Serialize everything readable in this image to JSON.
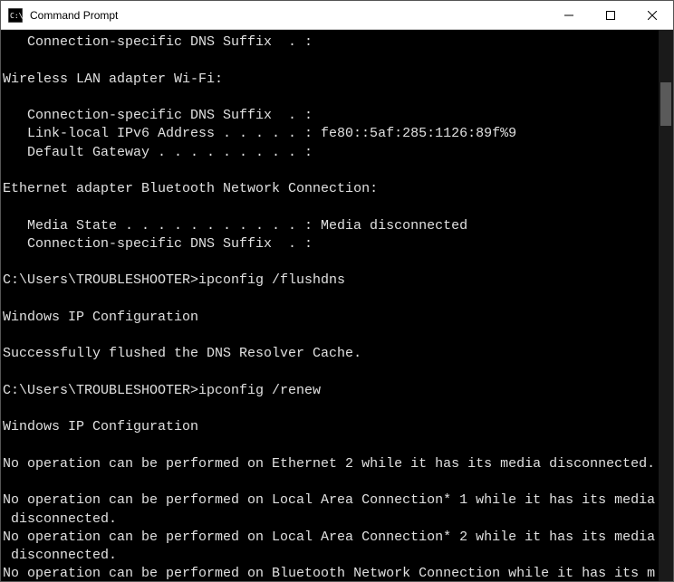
{
  "window": {
    "title": "Command Prompt"
  },
  "terminal": {
    "lines": [
      {
        "cls": "indent1",
        "text": "Connection-specific DNS Suffix  . :"
      },
      {
        "cls": "",
        "text": ""
      },
      {
        "cls": "",
        "text": "Wireless LAN adapter Wi-Fi:"
      },
      {
        "cls": "",
        "text": ""
      },
      {
        "cls": "indent1",
        "text": "Connection-specific DNS Suffix  . :"
      },
      {
        "cls": "indent1",
        "text": "Link-local IPv6 Address . . . . . : fe80::5af:285:1126:89f%9"
      },
      {
        "cls": "indent1",
        "text": "Default Gateway . . . . . . . . . :"
      },
      {
        "cls": "",
        "text": ""
      },
      {
        "cls": "",
        "text": "Ethernet adapter Bluetooth Network Connection:"
      },
      {
        "cls": "",
        "text": ""
      },
      {
        "cls": "indent1",
        "text": "Media State . . . . . . . . . . . : Media disconnected"
      },
      {
        "cls": "indent1",
        "text": "Connection-specific DNS Suffix  . :"
      },
      {
        "cls": "",
        "text": ""
      },
      {
        "cls": "",
        "text": "C:\\Users\\TROUBLESHOOTER>ipconfig /flushdns"
      },
      {
        "cls": "",
        "text": ""
      },
      {
        "cls": "",
        "text": "Windows IP Configuration"
      },
      {
        "cls": "",
        "text": ""
      },
      {
        "cls": "",
        "text": "Successfully flushed the DNS Resolver Cache."
      },
      {
        "cls": "",
        "text": ""
      },
      {
        "cls": "",
        "text": "C:\\Users\\TROUBLESHOOTER>ipconfig /renew"
      },
      {
        "cls": "",
        "text": ""
      },
      {
        "cls": "",
        "text": "Windows IP Configuration"
      },
      {
        "cls": "",
        "text": ""
      },
      {
        "cls": "",
        "text": "No operation can be performed on Ethernet 2 while it has its media disconnected."
      },
      {
        "cls": "",
        "text": ""
      },
      {
        "cls": "",
        "text": "No operation can be performed on Local Area Connection* 1 while it has its media"
      },
      {
        "cls": "wrap-indent",
        "text": "disconnected."
      },
      {
        "cls": "",
        "text": "No operation can be performed on Local Area Connection* 2 while it has its media"
      },
      {
        "cls": "wrap-indent",
        "text": "disconnected."
      },
      {
        "cls": "",
        "text": "No operation can be performed on Bluetooth Network Connection while it has its m"
      }
    ]
  }
}
